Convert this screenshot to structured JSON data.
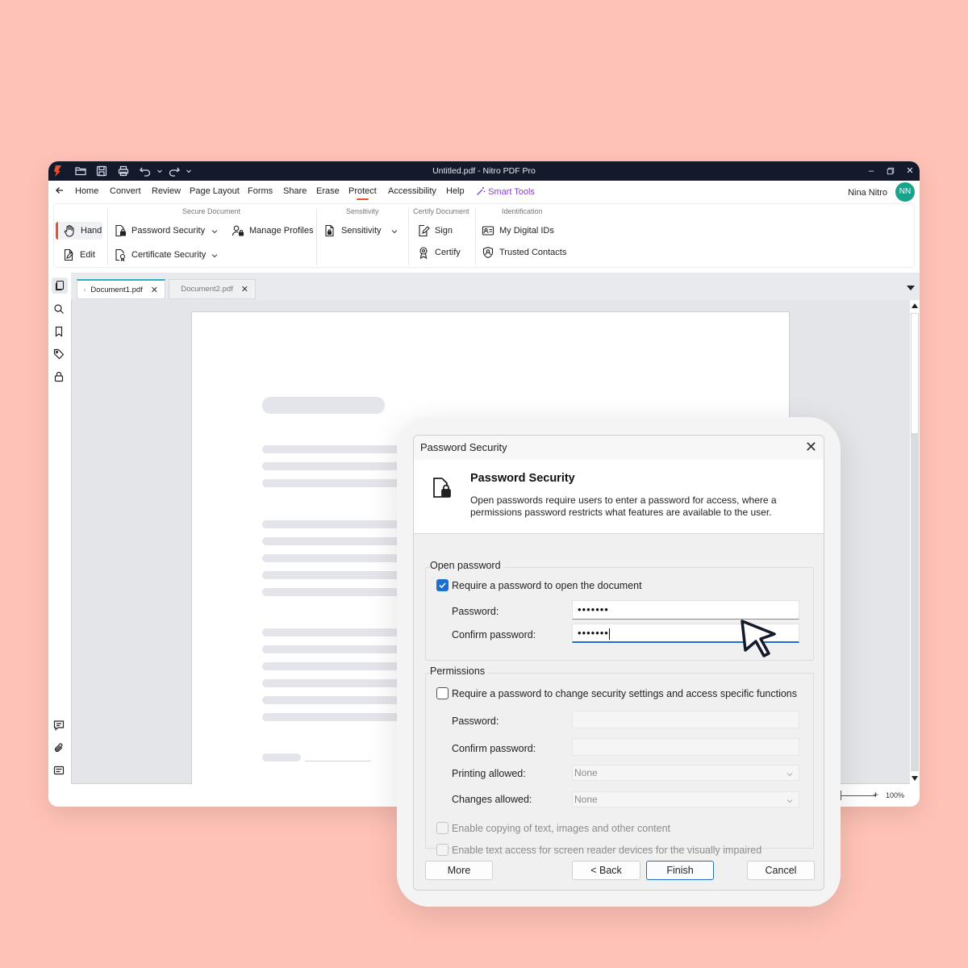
{
  "window": {
    "title": "Untitled.pdf - Nitro PDF Pro"
  },
  "menu": {
    "items": [
      "Home",
      "Convert",
      "Review",
      "Page Layout",
      "Forms",
      "Share",
      "Erase",
      "Protect",
      "Accessibility",
      "Help"
    ],
    "active": "Protect",
    "smart_tools": "Smart Tools",
    "user_name": "Nina Nitro",
    "avatar_initials": "NN"
  },
  "ribbon": {
    "groups": {
      "secure_document": "Secure Document",
      "sensitivity": "Sensitivity",
      "certify_document": "Certify Document",
      "identification": "Identification"
    },
    "buttons": {
      "hand": "Hand",
      "edit": "Edit",
      "password_security": "Password Security",
      "certificate_security": "Certificate Security",
      "manage_profiles": "Manage Profiles",
      "sensitivity": "Sensitivity",
      "sign": "Sign",
      "certify": "Certify",
      "my_digital_ids": "My Digital IDs",
      "trusted_contacts": "Trusted Contacts"
    }
  },
  "tabs": [
    {
      "label": "Document1.pdf",
      "active": true
    },
    {
      "label": "Document2.pdf",
      "active": false
    }
  ],
  "status": {
    "zoom": "100%"
  },
  "dialog": {
    "title": "Password Security",
    "heading": "Password Security",
    "description": "Open passwords require users to enter a password for access, where a permissions password restricts what features are available to the user.",
    "open_password": {
      "legend": "Open password",
      "require_label": "Require a password to open the document",
      "require_checked": true,
      "password_label": "Password:",
      "password_value": "•••••••",
      "confirm_label": "Confirm password:",
      "confirm_value": "•••••••"
    },
    "permissions": {
      "legend": "Permissions",
      "require_label": "Require a password to change security settings and access specific functions",
      "require_checked": false,
      "password_label": "Password:",
      "confirm_label": "Confirm password:",
      "printing_label": "Printing allowed:",
      "printing_value": "None",
      "changes_label": "Changes allowed:",
      "changes_value": "None",
      "copy_label": "Enable copying of text, images and other content",
      "screen_reader_label": "Enable text access for screen reader devices for the visually impaired"
    },
    "buttons": {
      "more": "More",
      "back": "< Back",
      "finish": "Finish",
      "cancel": "Cancel"
    }
  },
  "colors": {
    "background": "#ffc2b6",
    "titlebar": "#131a2b",
    "accent": "#e8532b",
    "tab_accent": "#2bb3c6",
    "checkbox": "#1d6fce",
    "avatar": "#1aa38a",
    "smart_tools": "#8a3fd1"
  }
}
